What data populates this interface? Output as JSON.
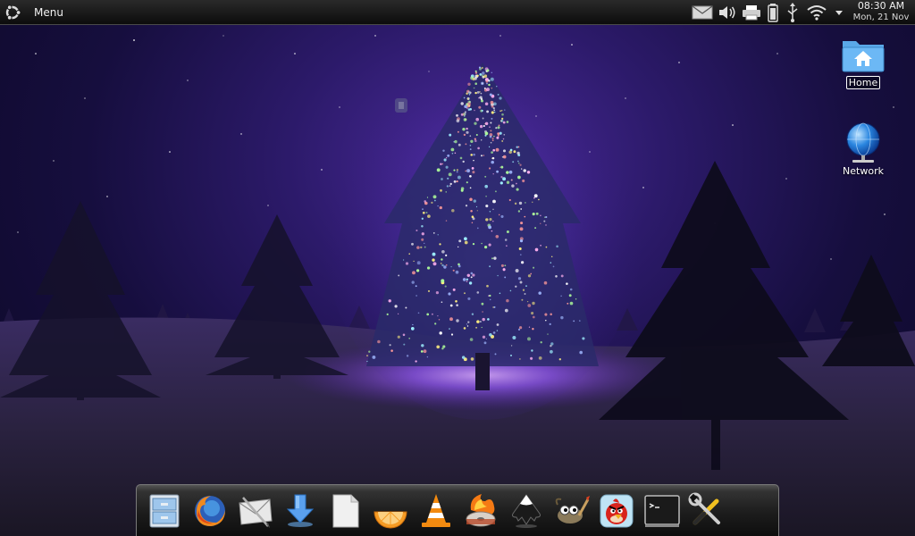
{
  "panel": {
    "menu_label": "Menu",
    "tray_icons": [
      "mail-icon",
      "volume-icon",
      "printer-icon",
      "battery-icon",
      "usb-icon",
      "wifi-icon",
      "dropdown-arrow-icon"
    ],
    "clock_time": "08:30 AM",
    "clock_date": "Mon, 21 Nov"
  },
  "desktop_icons": [
    {
      "name": "home-folder-icon",
      "label": "Home",
      "selected": true
    },
    {
      "name": "network-globe-icon",
      "label": "Network",
      "selected": false
    }
  ],
  "dock": {
    "items": [
      {
        "icon": "file-cabinet-icon",
        "app": "files"
      },
      {
        "icon": "firefox-icon",
        "app": "firefox"
      },
      {
        "icon": "mail-envelope-icon",
        "app": "mail"
      },
      {
        "icon": "download-arrow-icon",
        "app": "downloads"
      },
      {
        "icon": "document-icon",
        "app": "document"
      },
      {
        "icon": "orange-slice-icon",
        "app": "media-player"
      },
      {
        "icon": "vlc-cone-icon",
        "app": "vlc"
      },
      {
        "icon": "burning-disc-icon",
        "app": "disc-burner"
      },
      {
        "icon": "inkscape-icon",
        "app": "inkscape"
      },
      {
        "icon": "gimp-icon",
        "app": "gimp"
      },
      {
        "icon": "angry-birds-icon",
        "app": "angry-birds"
      },
      {
        "icon": "terminal-icon",
        "app": "terminal"
      },
      {
        "icon": "settings-tools-icon",
        "app": "settings"
      }
    ]
  },
  "colors": {
    "sky_center": "#4a2a9a",
    "sky_edge": "#0b0822",
    "snow_glow": "#b388ff",
    "panel_bg": "#111111"
  }
}
